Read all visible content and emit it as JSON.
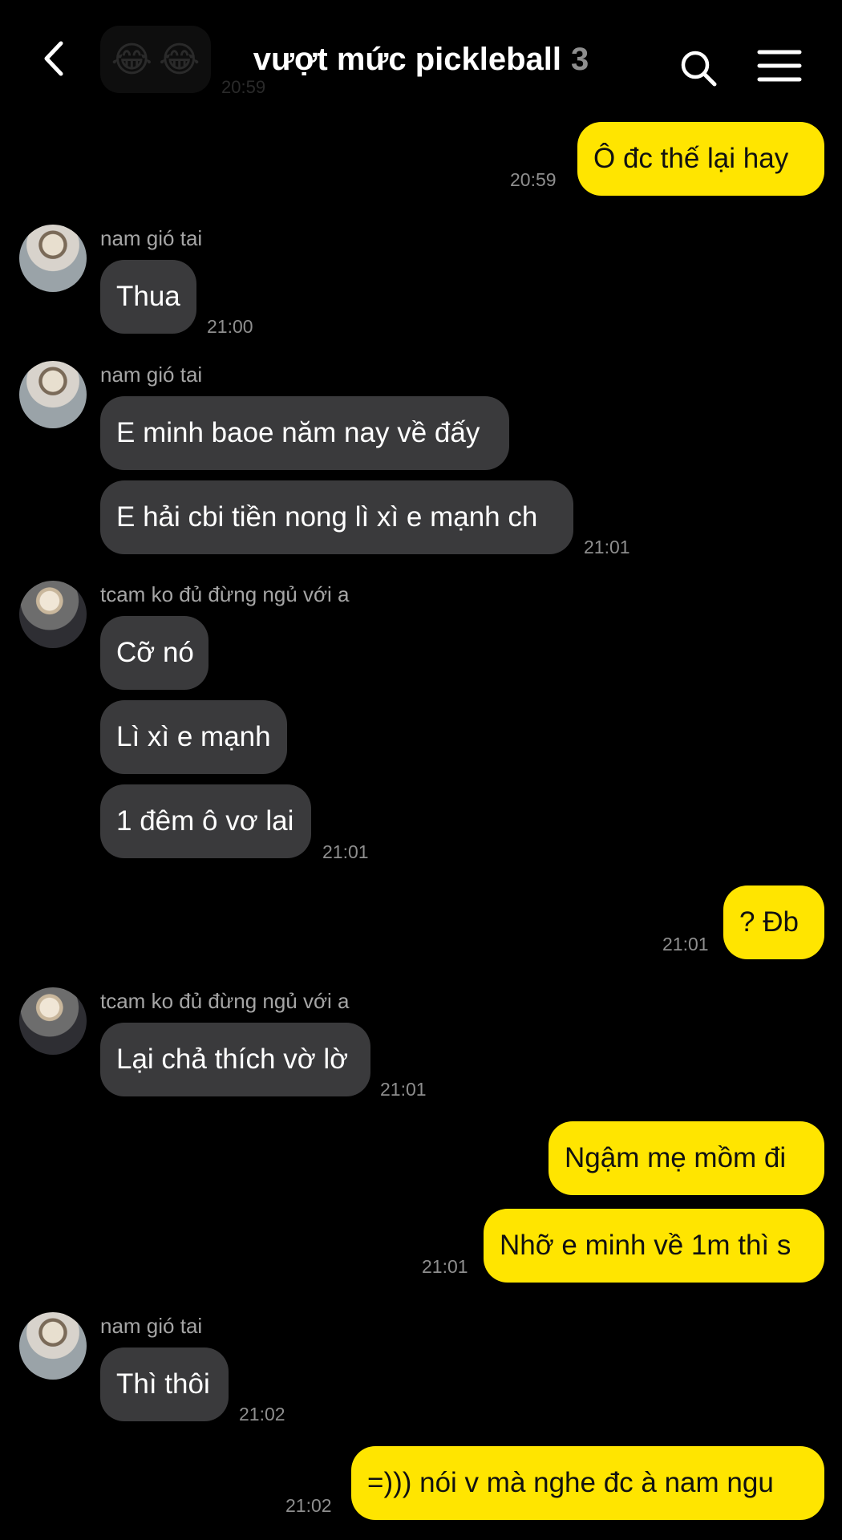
{
  "header": {
    "faded_time": "20:59",
    "title": "vượt mức pickleball",
    "member_count": "3"
  },
  "messages": {
    "m1": {
      "text": "Ô đc thế lại hay",
      "time": "20:59"
    },
    "m2": {
      "sender": "nam gió tai",
      "text": "Thua",
      "time": "21:00"
    },
    "m3": {
      "sender": "nam gió tai",
      "text1": "E minh baoe năm nay về đấy",
      "text2": "E hải cbi tiền nong lì xì e mạnh ch",
      "time": "21:01"
    },
    "m4": {
      "sender": "tcam ko đủ đừng ngủ với a",
      "text1": "Cỡ nó",
      "text2": "Lì xì e mạnh",
      "text3": "1 đêm ô vơ lai",
      "time": "21:01"
    },
    "m5": {
      "text": "? Đb",
      "time": "21:01"
    },
    "m6": {
      "sender": "tcam ko đủ đừng ngủ với a",
      "text": "Lại chả thích vờ lờ",
      "time": "21:01"
    },
    "m7": {
      "text1": "Ngậm mẹ mồm đi",
      "text2": "Nhỡ e minh về 1m thì s",
      "time": "21:01"
    },
    "m8": {
      "sender": "nam gió tai",
      "text": "Thì thôi",
      "time": "21:02"
    },
    "m9": {
      "text": "=))) nói v mà nghe đc à nam ngu",
      "time": "21:02"
    }
  }
}
